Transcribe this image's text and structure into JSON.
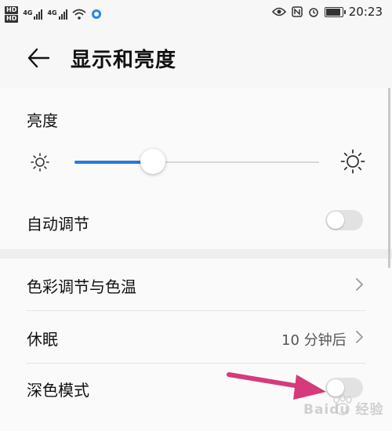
{
  "status_bar": {
    "hd_top": "HD",
    "hd_bottom": "HD",
    "net1": "4G",
    "net2": "4G",
    "time": "20:23",
    "icons": [
      "wifi-icon",
      "eye-icon",
      "nfc-icon",
      "alarm-icon",
      "battery-icon"
    ],
    "battery_level": 0.9
  },
  "header": {
    "title": "显示和亮度"
  },
  "brightness": {
    "section_title": "亮度",
    "level": 0.32,
    "accent_color": "#2a7bd6"
  },
  "auto_adjust": {
    "label": "自动调节",
    "enabled": false
  },
  "list": {
    "color_temp": {
      "label": "色彩调节与色温"
    },
    "sleep": {
      "label": "休眠",
      "value": "10 分钟后"
    },
    "dark_mode": {
      "label": "深色模式",
      "enabled": false
    }
  },
  "annotation": {
    "arrow_color": "#d63a7a"
  },
  "watermark": {
    "text": "Baidu 经验"
  }
}
